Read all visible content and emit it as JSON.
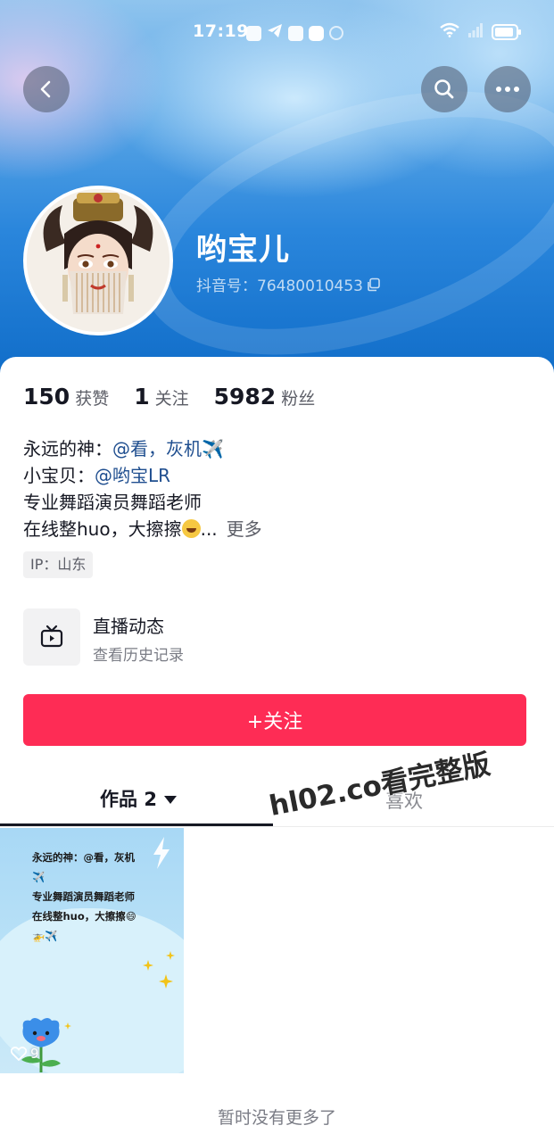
{
  "status_bar": {
    "time": "17:19",
    "icons": [
      "message-icon",
      "telegram-icon",
      "mail-icon",
      "browser-icon",
      "nfc-icon"
    ],
    "right_icons": [
      "wifi-icon",
      "signal-icon",
      "battery-icon"
    ]
  },
  "nav": {
    "back": "back-icon",
    "search": "search-icon",
    "more": "more-icon"
  },
  "profile": {
    "nickname": "哟宝儿",
    "douyin_id": "抖音号：76480010453"
  },
  "stats": [
    {
      "num": "150",
      "label": "获赞"
    },
    {
      "num": "1",
      "label": "关注"
    },
    {
      "num": "5982",
      "label": "粉丝"
    }
  ],
  "bio": {
    "line1_prefix": "永远的神：",
    "line1_mention": "@看，灰机✈️",
    "line2_prefix": "小宝贝：",
    "line2_mention": "@哟宝LR",
    "line3": "专业舞蹈演员舞蹈老师",
    "line4": "在线整huo，大擦擦",
    "line4_ellipsis": "...",
    "more": "更多"
  },
  "ip_tag": "IP：山东",
  "live": {
    "title": "直播动态",
    "subtitle": "查看历史记录"
  },
  "follow_button": "+关注",
  "tabs": {
    "works": "作品 2",
    "second": "喜欢"
  },
  "watermark": "hl02.co看完整版",
  "video": {
    "text_line1": "永远的神：@看，灰机",
    "text_line2": "✈️",
    "text_line3": "专业舞蹈演员舞蹈老师",
    "text_line4": "在线整huo，大擦擦😄",
    "text_line5": "🚁✈️",
    "likes": "9"
  },
  "footer": "暂时没有更多了",
  "colors": {
    "accent": "#fe2c55",
    "mention": "#1f4e8f",
    "header_blue": "#0f6cc8"
  }
}
